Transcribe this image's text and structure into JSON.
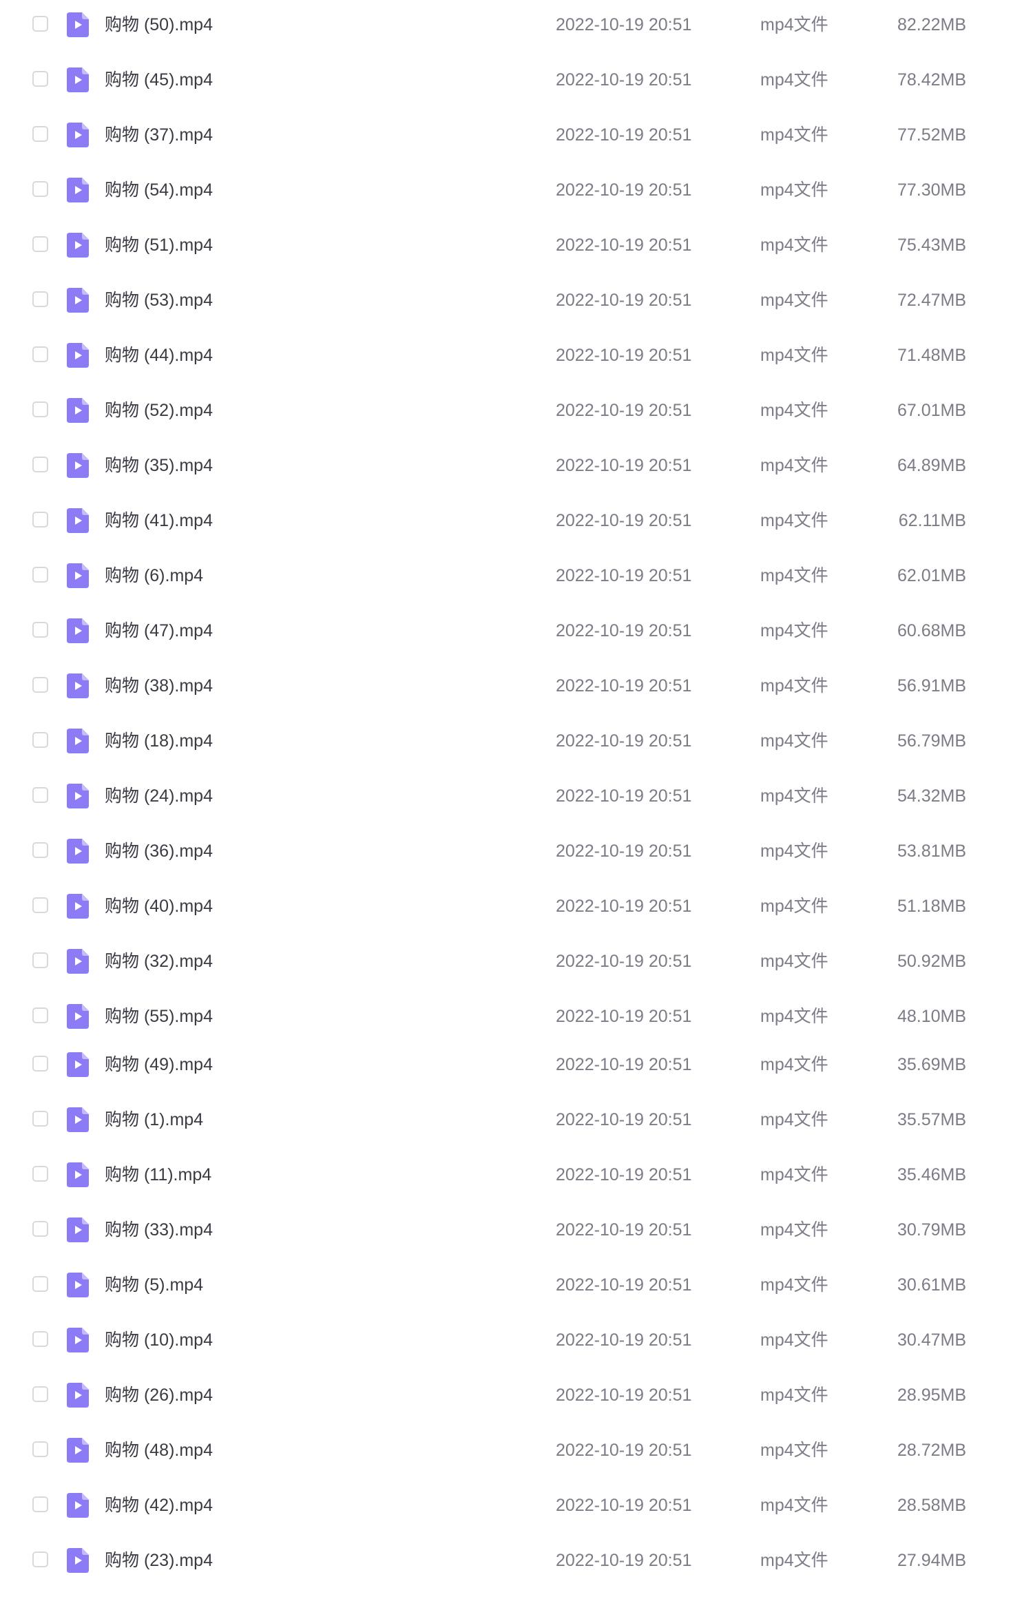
{
  "colors": {
    "icon_fill": "#8b7cf6",
    "icon_fold": "#c4bbfb",
    "checkbox_border": "#d8d9de"
  },
  "icons": {
    "file": "video-file-icon",
    "checkbox": "checkbox-unchecked"
  },
  "files": [
    {
      "name": "购物 (50).mp4",
      "date": "2022-10-19 20:51",
      "type": "mp4文件",
      "size": "82.22MB"
    },
    {
      "name": "购物 (45).mp4",
      "date": "2022-10-19 20:51",
      "type": "mp4文件",
      "size": "78.42MB"
    },
    {
      "name": "购物 (37).mp4",
      "date": "2022-10-19 20:51",
      "type": "mp4文件",
      "size": "77.52MB"
    },
    {
      "name": "购物 (54).mp4",
      "date": "2022-10-19 20:51",
      "type": "mp4文件",
      "size": "77.30MB"
    },
    {
      "name": "购物 (51).mp4",
      "date": "2022-10-19 20:51",
      "type": "mp4文件",
      "size": "75.43MB"
    },
    {
      "name": "购物 (53).mp4",
      "date": "2022-10-19 20:51",
      "type": "mp4文件",
      "size": "72.47MB"
    },
    {
      "name": "购物 (44).mp4",
      "date": "2022-10-19 20:51",
      "type": "mp4文件",
      "size": "71.48MB"
    },
    {
      "name": "购物 (52).mp4",
      "date": "2022-10-19 20:51",
      "type": "mp4文件",
      "size": "67.01MB"
    },
    {
      "name": "购物 (35).mp4",
      "date": "2022-10-19 20:51",
      "type": "mp4文件",
      "size": "64.89MB"
    },
    {
      "name": "购物 (41).mp4",
      "date": "2022-10-19 20:51",
      "type": "mp4文件",
      "size": "62.11MB"
    },
    {
      "name": "购物 (6).mp4",
      "date": "2022-10-19 20:51",
      "type": "mp4文件",
      "size": "62.01MB"
    },
    {
      "name": "购物 (47).mp4",
      "date": "2022-10-19 20:51",
      "type": "mp4文件",
      "size": "60.68MB"
    },
    {
      "name": "购物 (38).mp4",
      "date": "2022-10-19 20:51",
      "type": "mp4文件",
      "size": "56.91MB"
    },
    {
      "name": "购物 (18).mp4",
      "date": "2022-10-19 20:51",
      "type": "mp4文件",
      "size": "56.79MB"
    },
    {
      "name": "购物 (24).mp4",
      "date": "2022-10-19 20:51",
      "type": "mp4文件",
      "size": "54.32MB"
    },
    {
      "name": "购物 (36).mp4",
      "date": "2022-10-19 20:51",
      "type": "mp4文件",
      "size": "53.81MB"
    },
    {
      "name": "购物 (40).mp4",
      "date": "2022-10-19 20:51",
      "type": "mp4文件",
      "size": "51.18MB"
    },
    {
      "name": "购物 (32).mp4",
      "date": "2022-10-19 20:51",
      "type": "mp4文件",
      "size": "50.92MB"
    },
    {
      "name": "购物 (55).mp4",
      "date": "2022-10-19 20:51",
      "type": "mp4文件",
      "size": "48.10MB"
    },
    {
      "name": "购物 (49).mp4",
      "date": "2022-10-19 20:51",
      "type": "mp4文件",
      "size": "35.69MB"
    },
    {
      "name": "购物 (1).mp4",
      "date": "2022-10-19 20:51",
      "type": "mp4文件",
      "size": "35.57MB"
    },
    {
      "name": "购物 (11).mp4",
      "date": "2022-10-19 20:51",
      "type": "mp4文件",
      "size": "35.46MB"
    },
    {
      "name": "购物 (33).mp4",
      "date": "2022-10-19 20:51",
      "type": "mp4文件",
      "size": "30.79MB"
    },
    {
      "name": "购物 (5).mp4",
      "date": "2022-10-19 20:51",
      "type": "mp4文件",
      "size": "30.61MB"
    },
    {
      "name": "购物 (10).mp4",
      "date": "2022-10-19 20:51",
      "type": "mp4文件",
      "size": "30.47MB"
    },
    {
      "name": "购物 (26).mp4",
      "date": "2022-10-19 20:51",
      "type": "mp4文件",
      "size": "28.95MB"
    },
    {
      "name": "购物 (48).mp4",
      "date": "2022-10-19 20:51",
      "type": "mp4文件",
      "size": "28.72MB"
    },
    {
      "name": "购物 (42).mp4",
      "date": "2022-10-19 20:51",
      "type": "mp4文件",
      "size": "28.58MB"
    },
    {
      "name": "购物 (23).mp4",
      "date": "2022-10-19 20:51",
      "type": "mp4文件",
      "size": "27.94MB"
    }
  ]
}
